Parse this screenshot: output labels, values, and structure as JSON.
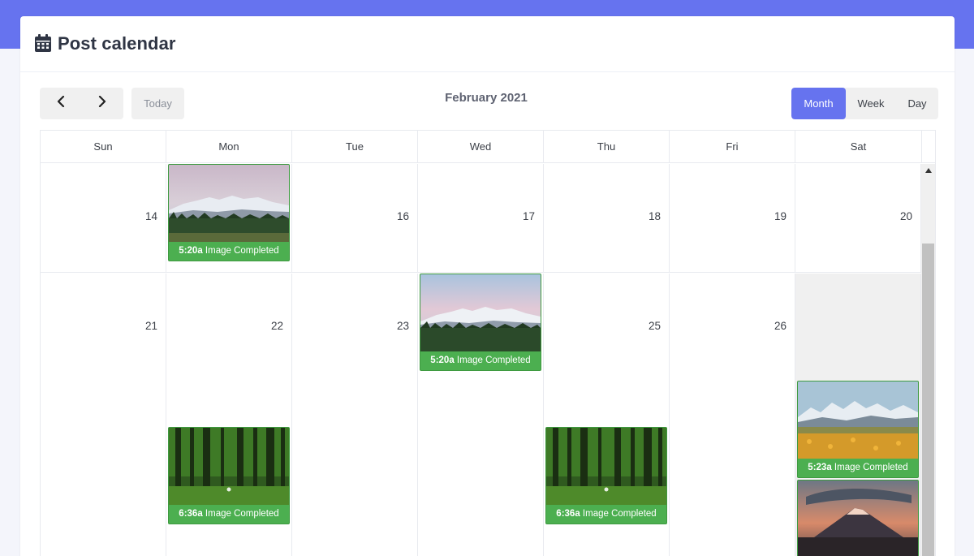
{
  "header": {
    "title": "Post calendar",
    "icon": "calendar-icon"
  },
  "toolbar": {
    "prev_icon": "chevron-left-icon",
    "next_icon": "chevron-right-icon",
    "today_label": "Today",
    "month_title": "February 2021",
    "views": [
      {
        "label": "Month",
        "active": true
      },
      {
        "label": "Week",
        "active": false
      },
      {
        "label": "Day",
        "active": false
      }
    ]
  },
  "weekdays": [
    "Sun",
    "Mon",
    "Tue",
    "Wed",
    "Thu",
    "Fri",
    "Sat"
  ],
  "weeks": [
    {
      "days": [
        "14",
        "",
        "16",
        "17",
        "18",
        "19",
        "20"
      ]
    },
    {
      "days": [
        "21",
        "22",
        "23",
        "",
        "25",
        "26",
        ""
      ]
    }
  ],
  "events": [
    {
      "time": "5:20a",
      "label": "Image Completed",
      "image": "snowy-mountains"
    },
    {
      "time": "5:20a",
      "label": "Image Completed",
      "image": "snowy-mountains"
    },
    {
      "time": "6:36a",
      "label": "Image Completed",
      "image": "green-forest"
    },
    {
      "time": "6:36a",
      "label": "Image Completed",
      "image": "green-forest"
    },
    {
      "time": "5:23a",
      "label": "Image Completed",
      "image": "mountain-flower-field"
    },
    {
      "time": "",
      "label": "",
      "image": "sunset-volcano"
    }
  ],
  "colors": {
    "accent": "#6673ef",
    "event_green": "#4caf50"
  }
}
